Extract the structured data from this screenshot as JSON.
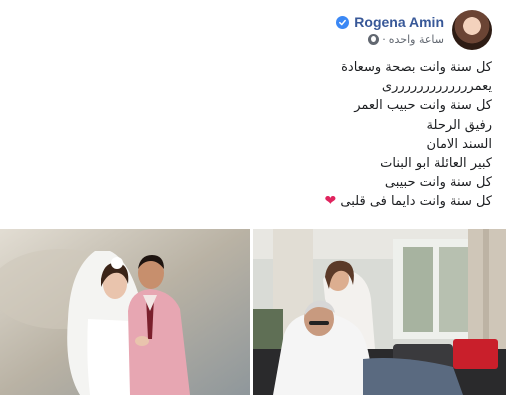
{
  "post": {
    "author_name": "Rogena Amin",
    "timestamp": "ساعة واحده",
    "separator": "·",
    "lines": [
      "كل سنة وانت بصحة وسعادة",
      "يعمرررررررررررررى",
      "كل سنة وانت حبيب العمر",
      "رفيق الرحلة",
      "السند الامان",
      "كبير العائلة ابو البنات",
      "كل سنة وانت حبيبى",
      "كل سنة وانت دايما فى قلبى"
    ],
    "emoji": "❤",
    "icons": {
      "verified": "verified-badge-icon",
      "privacy": "globe-icon"
    },
    "colors": {
      "author": "#385898",
      "verified": "#3b88f5",
      "heart": "#e0245e",
      "meta_text": "#616770"
    }
  }
}
